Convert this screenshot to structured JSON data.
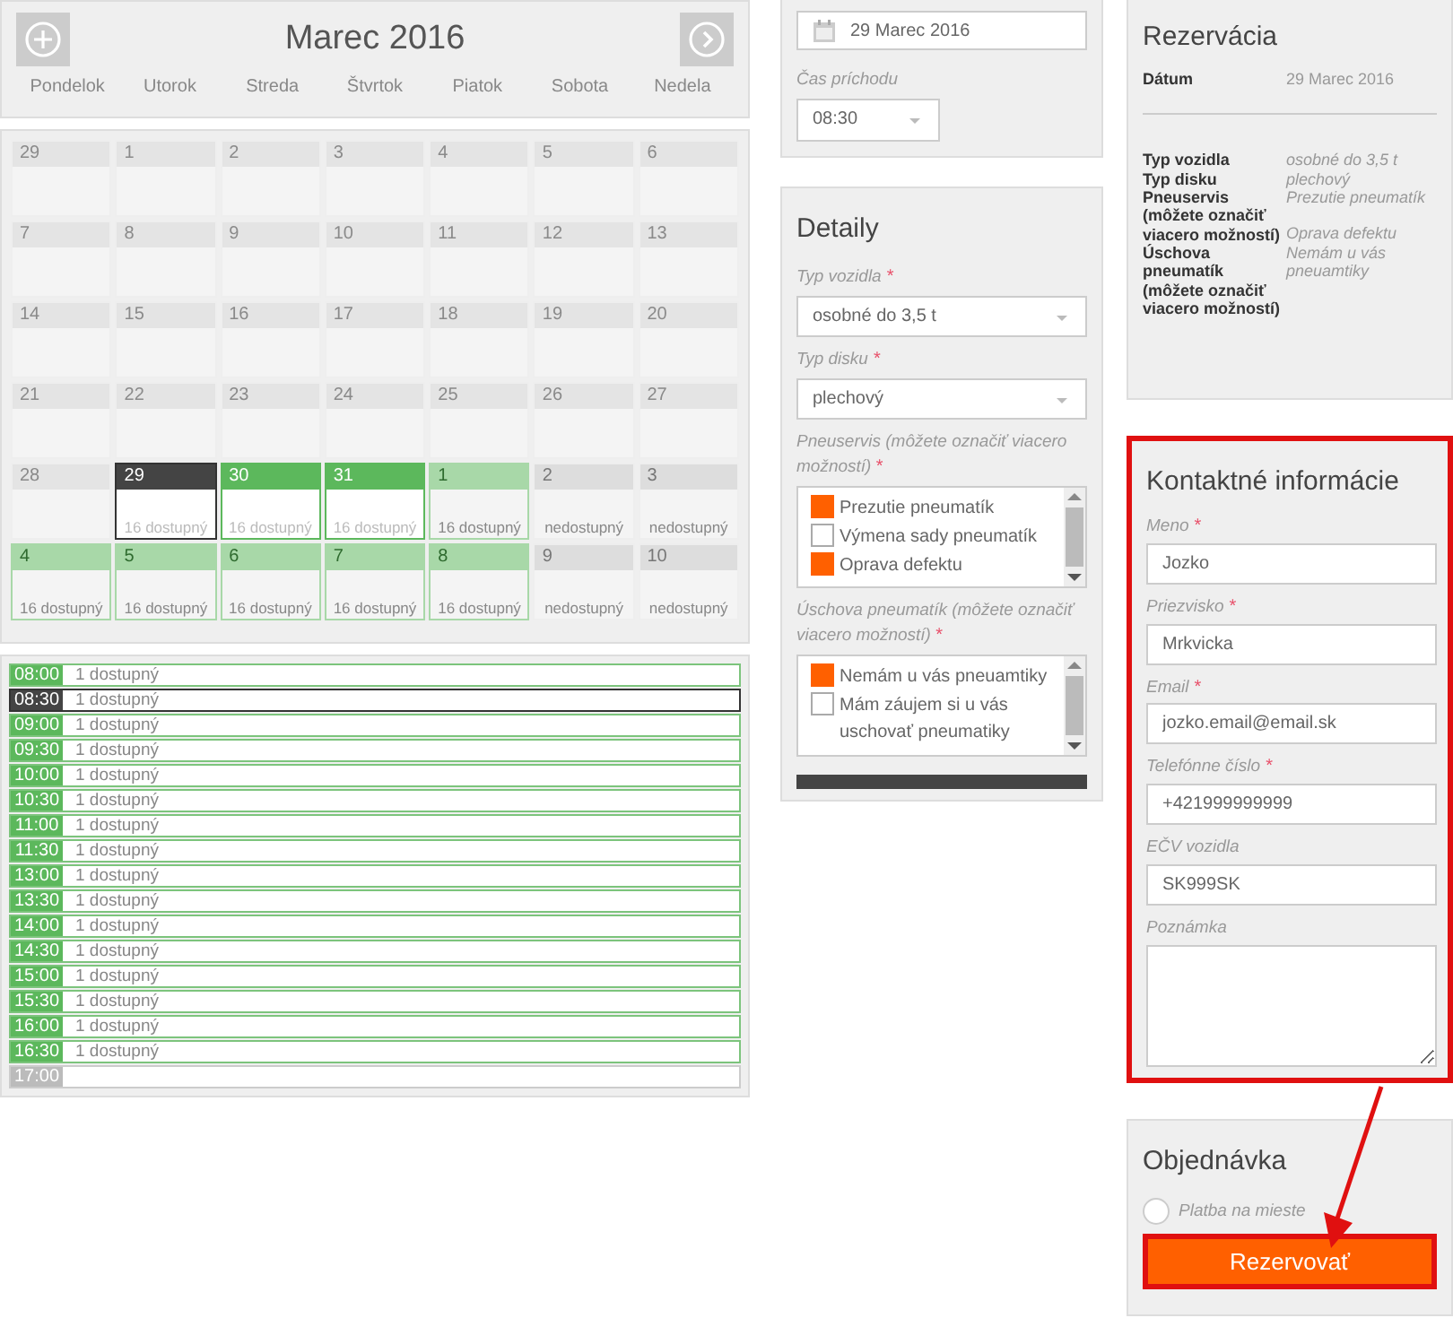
{
  "calendar": {
    "month": "Marec 2016",
    "weekdays": [
      "Pondelok",
      "Utorok",
      "Streda",
      "Štvrtok",
      "Piatok",
      "Sobota",
      "Nedela"
    ],
    "weeks": [
      [
        {
          "day": "29",
          "kind": "past",
          "selected": false
        },
        {
          "day": "1",
          "kind": "past",
          "selected": false
        },
        {
          "day": "2",
          "kind": "past",
          "selected": false
        },
        {
          "day": "3",
          "kind": "past",
          "selected": false
        },
        {
          "day": "4",
          "kind": "past",
          "selected": false
        },
        {
          "day": "5",
          "kind": "past",
          "selected": false
        },
        {
          "day": "6",
          "kind": "past",
          "selected": false
        }
      ],
      [
        {
          "day": "7",
          "kind": "past",
          "selected": false
        },
        {
          "day": "8",
          "kind": "past",
          "selected": false
        },
        {
          "day": "9",
          "kind": "past",
          "selected": false
        },
        {
          "day": "10",
          "kind": "past",
          "selected": false
        },
        {
          "day": "11",
          "kind": "past",
          "selected": false
        },
        {
          "day": "12",
          "kind": "past",
          "selected": false
        },
        {
          "day": "13",
          "kind": "past",
          "selected": false
        }
      ],
      [
        {
          "day": "14",
          "kind": "past",
          "selected": false
        },
        {
          "day": "15",
          "kind": "past",
          "selected": false
        },
        {
          "day": "16",
          "kind": "past",
          "selected": false
        },
        {
          "day": "17",
          "kind": "past",
          "selected": false
        },
        {
          "day": "18",
          "kind": "past",
          "selected": false
        },
        {
          "day": "19",
          "kind": "past",
          "selected": false
        },
        {
          "day": "20",
          "kind": "past",
          "selected": false
        }
      ],
      [
        {
          "day": "21",
          "kind": "past",
          "selected": false
        },
        {
          "day": "22",
          "kind": "past",
          "selected": false
        },
        {
          "day": "23",
          "kind": "past",
          "selected": false
        },
        {
          "day": "24",
          "kind": "past",
          "selected": false
        },
        {
          "day": "25",
          "kind": "past",
          "selected": false
        },
        {
          "day": "26",
          "kind": "past",
          "selected": false
        },
        {
          "day": "27",
          "kind": "past",
          "selected": false
        }
      ],
      [
        {
          "day": "28",
          "kind": "past",
          "selected": false
        },
        {
          "day": "29",
          "kind": "available",
          "selected": true,
          "status": "16 dostupný"
        },
        {
          "day": "30",
          "kind": "available",
          "selected": false,
          "status": "16 dostupný"
        },
        {
          "day": "31",
          "kind": "available",
          "selected": false,
          "status": "16 dostupný"
        },
        {
          "day": "1",
          "kind": "next-month",
          "selected": false,
          "status": "16 dostupný"
        },
        {
          "day": "2",
          "kind": "unavailable",
          "selected": false,
          "status": "nedostupný"
        },
        {
          "day": "3",
          "kind": "unavailable",
          "selected": false,
          "status": "nedostupný"
        }
      ],
      [
        {
          "day": "4",
          "kind": "next-month",
          "selected": false,
          "status": "16 dostupný"
        },
        {
          "day": "5",
          "kind": "next-month",
          "selected": false,
          "status": "16 dostupný"
        },
        {
          "day": "6",
          "kind": "next-month",
          "selected": false,
          "status": "16 dostupný"
        },
        {
          "day": "7",
          "kind": "next-month",
          "selected": false,
          "status": "16 dostupný"
        },
        {
          "day": "8",
          "kind": "next-month",
          "selected": false,
          "status": "16 dostupný"
        },
        {
          "day": "9",
          "kind": "unavailable",
          "selected": false,
          "status": "nedostupný"
        },
        {
          "day": "10",
          "kind": "unavailable",
          "selected": false,
          "status": "nedostupný"
        }
      ]
    ]
  },
  "slots": [
    {
      "time": "08:00",
      "status": "1 dostupný",
      "kind": "available",
      "selected": false
    },
    {
      "time": "08:30",
      "status": "1 dostupný",
      "kind": "available",
      "selected": true
    },
    {
      "time": "09:00",
      "status": "1 dostupný",
      "kind": "available",
      "selected": false
    },
    {
      "time": "09:30",
      "status": "1 dostupný",
      "kind": "available",
      "selected": false
    },
    {
      "time": "10:00",
      "status": "1 dostupný",
      "kind": "available",
      "selected": false
    },
    {
      "time": "10:30",
      "status": "1 dostupný",
      "kind": "available",
      "selected": false
    },
    {
      "time": "11:00",
      "status": "1 dostupný",
      "kind": "available",
      "selected": false
    },
    {
      "time": "11:30",
      "status": "1 dostupný",
      "kind": "available",
      "selected": false
    },
    {
      "time": "13:00",
      "status": "1 dostupný",
      "kind": "available",
      "selected": false
    },
    {
      "time": "13:30",
      "status": "1 dostupný",
      "kind": "available",
      "selected": false
    },
    {
      "time": "14:00",
      "status": "1 dostupný",
      "kind": "available",
      "selected": false
    },
    {
      "time": "14:30",
      "status": "1 dostupný",
      "kind": "available",
      "selected": false
    },
    {
      "time": "15:00",
      "status": "1 dostupný",
      "kind": "available",
      "selected": false
    },
    {
      "time": "15:30",
      "status": "1 dostupný",
      "kind": "available",
      "selected": false
    },
    {
      "time": "16:00",
      "status": "1 dostupný",
      "kind": "available",
      "selected": false
    },
    {
      "time": "16:30",
      "status": "1 dostupný",
      "kind": "available",
      "selected": false
    },
    {
      "time": "17:00",
      "kind": "closed",
      "selected": false
    }
  ],
  "date_panel": {
    "date": "29 Marec 2016",
    "time_label": "Čas príchodu",
    "time": "08:30"
  },
  "details": {
    "title": "Detaily",
    "selects": [
      {
        "label": "Typ vozidla",
        "required_mark": "*",
        "value": "osobné do 3,5 t"
      },
      {
        "label": "Typ disku",
        "required_mark": "*",
        "value": "plechový"
      }
    ],
    "lists": [
      {
        "label": "Pneuservis (môžete označiť viacero možností)",
        "required_mark": "*",
        "options": [
          {
            "label": "Prezutie pneumatík",
            "checked": true
          },
          {
            "label": "Výmena sady pneumatík",
            "checked": false
          },
          {
            "label": "Oprava defektu",
            "checked": true
          }
        ]
      },
      {
        "label": "Úschova pneumatík (môžete označiť viacero možností)",
        "required_mark": "*",
        "options": [
          {
            "label": "Nemám u vás pneuamtiky",
            "checked": true
          },
          {
            "label": "Mám záujem si u vás uschovať pneumatiky",
            "checked": false
          }
        ]
      }
    ]
  },
  "summary": {
    "title": "Rezervácia",
    "date_label": "Dátum",
    "date": "29 Marec 2016",
    "rows": [
      {
        "label": "Typ vozidla",
        "values": [
          "osobné do 3,5 t"
        ]
      },
      {
        "label": "Typ disku",
        "values": [
          "plechový"
        ]
      },
      {
        "label": "Pneuservis (môžete označiť viacero možností)",
        "values": [
          "Prezutie pneumatík",
          "Oprava defektu"
        ]
      },
      {
        "label": "Úschova pneumatík (môžete označiť viacero možností)",
        "values": [
          "Nemám u vás pneuamtiky"
        ]
      }
    ]
  },
  "contact": {
    "title": "Kontaktné informácie",
    "fields": [
      {
        "label": "Meno",
        "required_mark": "*",
        "value": "Jozko",
        "kind": "text"
      },
      {
        "label": "Priezvisko",
        "required_mark": "*",
        "value": "Mrkvicka",
        "kind": "text"
      },
      {
        "label": "Email",
        "required_mark": "*",
        "value": "jozko.email@email.sk",
        "kind": "text"
      },
      {
        "label": "Telefónne číslo",
        "required_mark": "*",
        "value": "+421999999999",
        "kind": "text"
      },
      {
        "label": "EČV vozidla",
        "value": "SK999SK",
        "kind": "text"
      },
      {
        "label": "Poznámka",
        "kind": "textarea"
      }
    ]
  },
  "order": {
    "title": "Objednávka",
    "payment": {
      "label": "Platba na mieste",
      "selected": false
    },
    "submit": "Rezervovať"
  }
}
